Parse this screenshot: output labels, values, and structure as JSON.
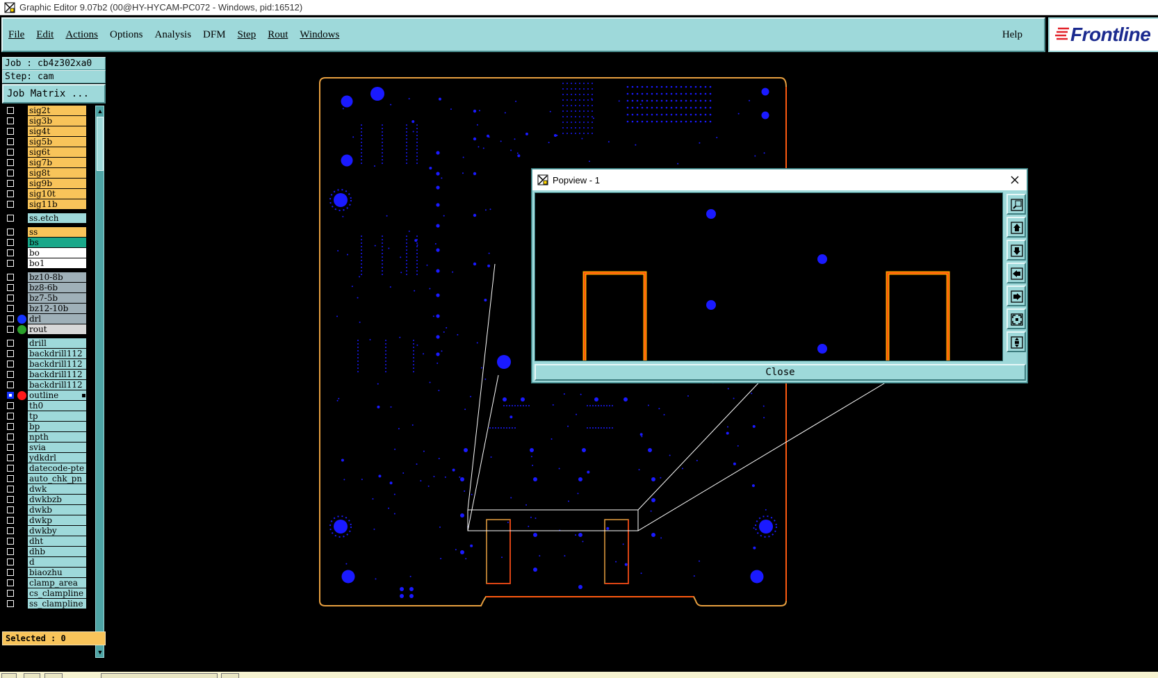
{
  "window": {
    "title": "Graphic Editor 9.07b2 (00@HY-HYCAM-PC072 - Windows, pid:16512)"
  },
  "menu": {
    "items": [
      {
        "label": "File",
        "underline": true
      },
      {
        "label": "Edit",
        "underline": true
      },
      {
        "label": "Actions",
        "underline": true
      },
      {
        "label": "Options",
        "underline": false
      },
      {
        "label": "Analysis",
        "underline": false
      },
      {
        "label": "DFM",
        "underline": false
      },
      {
        "label": "Step",
        "underline": true
      },
      {
        "label": "Rout",
        "underline": true
      },
      {
        "label": "Windows",
        "underline": true
      }
    ],
    "help": "Help",
    "logo": "Frontline"
  },
  "panel": {
    "job": "Job : cb4z302xa0",
    "step": "Step: cam",
    "job_matrix": "Job Matrix ...",
    "selected": "Selected : 0"
  },
  "colors": {
    "signal": "#f8c45a",
    "etch": "#9ed9da",
    "bs": "#1aa88a",
    "white": "#ffffff",
    "bz": "#9fb0b8",
    "rout": "#d8d8d8",
    "drill": "#9ed9da",
    "drl_dot": "#1434ff",
    "rout_dot": "#2aa02a",
    "outline_dot": "#ff1a1a",
    "pad_blue": "#1a1aff",
    "outline_orange": "#f0a020",
    "outline_red": "#ff4010"
  },
  "layers": [
    {
      "name": "sig2t",
      "color": "#f8c45a"
    },
    {
      "name": "sig3b",
      "color": "#f8c45a"
    },
    {
      "name": "sig4t",
      "color": "#f8c45a"
    },
    {
      "name": "sig5b",
      "color": "#f8c45a"
    },
    {
      "name": "sig6t",
      "color": "#f8c45a"
    },
    {
      "name": "sig7b",
      "color": "#f8c45a"
    },
    {
      "name": "sig8t",
      "color": "#f8c45a"
    },
    {
      "name": "sig9b",
      "color": "#f8c45a"
    },
    {
      "name": "sig10t",
      "color": "#f8c45a"
    },
    {
      "name": "sig11b",
      "color": "#f8c45a"
    },
    {
      "name": "ss.etch",
      "color": "#9ed9da",
      "gap": true
    },
    {
      "name": "ss",
      "color": "#f8c45a",
      "gap": true
    },
    {
      "name": "bs",
      "color": "#1aa88a"
    },
    {
      "name": "bo",
      "color": "#ffffff"
    },
    {
      "name": "bo1",
      "color": "#ffffff"
    },
    {
      "name": "bz10-8b",
      "color": "#9fb0b8",
      "gap": true
    },
    {
      "name": "bz8-6b",
      "color": "#9fb0b8"
    },
    {
      "name": "bz7-5b",
      "color": "#9fb0b8"
    },
    {
      "name": "bz12-10b",
      "color": "#9fb0b8"
    },
    {
      "name": "drl",
      "color": "#9fb0b8",
      "dot": "#1434ff"
    },
    {
      "name": "rout",
      "color": "#d8d8d8",
      "dot": "#2aa02a"
    },
    {
      "name": "drill",
      "color": "#9ed9da",
      "gap": true
    },
    {
      "name": "backdrill112",
      "color": "#9ed9da"
    },
    {
      "name": "backdrill112",
      "color": "#9ed9da"
    },
    {
      "name": "backdrill112",
      "color": "#9ed9da"
    },
    {
      "name": "backdrill112",
      "color": "#9ed9da"
    },
    {
      "name": "outline",
      "color": "#9ed9da",
      "dot": "#ff1a1a",
      "checked": true,
      "selected": true
    },
    {
      "name": "th0",
      "color": "#9ed9da"
    },
    {
      "name": "tp",
      "color": "#9ed9da"
    },
    {
      "name": "bp",
      "color": "#9ed9da"
    },
    {
      "name": "npth",
      "color": "#9ed9da"
    },
    {
      "name": "svia",
      "color": "#9ed9da"
    },
    {
      "name": "ydkdrl",
      "color": "#9ed9da"
    },
    {
      "name": "datecode-pte",
      "color": "#9ed9da"
    },
    {
      "name": "auto_chk_pn",
      "color": "#9ed9da"
    },
    {
      "name": "dwk",
      "color": "#9ed9da"
    },
    {
      "name": "dwkbzb",
      "color": "#9ed9da"
    },
    {
      "name": "dwkb",
      "color": "#9ed9da"
    },
    {
      "name": "dwkp",
      "color": "#9ed9da"
    },
    {
      "name": "dwkby",
      "color": "#9ed9da"
    },
    {
      "name": "dht",
      "color": "#9ed9da"
    },
    {
      "name": "dhb",
      "color": "#9ed9da"
    },
    {
      "name": "d",
      "color": "#9ed9da"
    },
    {
      "name": "biaozhu",
      "color": "#9ed9da"
    },
    {
      "name": "clamp_area",
      "color": "#9ed9da"
    },
    {
      "name": "cs_clampline",
      "color": "#9ed9da"
    },
    {
      "name": "ss_clampline",
      "color": "#9ed9da"
    }
  ],
  "popview": {
    "title": "Popview - 1",
    "close": "Close",
    "tools": [
      "zoom-window-icon",
      "pan-up-icon",
      "pan-down-icon",
      "pan-left-icon",
      "pan-right-icon",
      "zoom-fit-icon",
      "zoom-center-icon"
    ]
  }
}
